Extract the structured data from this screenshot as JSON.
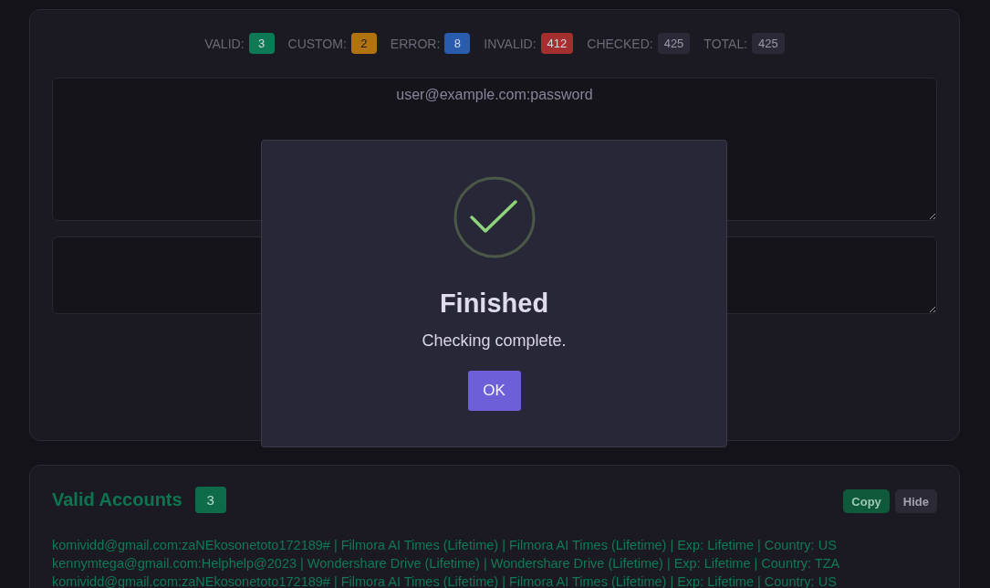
{
  "stats": [
    {
      "label": "VALID:",
      "value": "3",
      "color": "#0e7a55"
    },
    {
      "label": "CUSTOM:",
      "value": "2",
      "color": "#b1730f"
    },
    {
      "label": "ERROR:",
      "value": "8",
      "color": "#2a5cae"
    },
    {
      "label": "INVALID:",
      "value": "412",
      "color": "#a3302f"
    },
    {
      "label": "CHECKED:",
      "value": "425",
      "color": "#2a2935"
    },
    {
      "label": "TOTAL:",
      "value": "425",
      "color": "#2a2935"
    }
  ],
  "input": {
    "placeholder": "user@example.com:password"
  },
  "results": {
    "title": "Valid Accounts",
    "count": "3",
    "buttons": [
      {
        "label": "Copy",
        "kind": "copy"
      },
      {
        "label": "Hide",
        "kind": "hide"
      }
    ],
    "lines": [
      "komividd@gmail.com:zaNEkosonetoto172189# | Filmora AI Times (Lifetime) | Filmora AI Times (Lifetime) | Exp: Lifetime | Country: US",
      "kennymtega@gmail.com:Helphelp@2023 | Wondershare Drive (Lifetime) | Wondershare Drive (Lifetime) | Exp: Lifetime | Country: TZA",
      "komividd@gmail.com:zaNEkosonetoto172189# | Filmora AI Times (Lifetime) | Filmora AI Times (Lifetime) | Exp: Lifetime | Country: US"
    ]
  },
  "dialog": {
    "title": "Finished",
    "message": "Checking complete.",
    "button": "OK"
  }
}
